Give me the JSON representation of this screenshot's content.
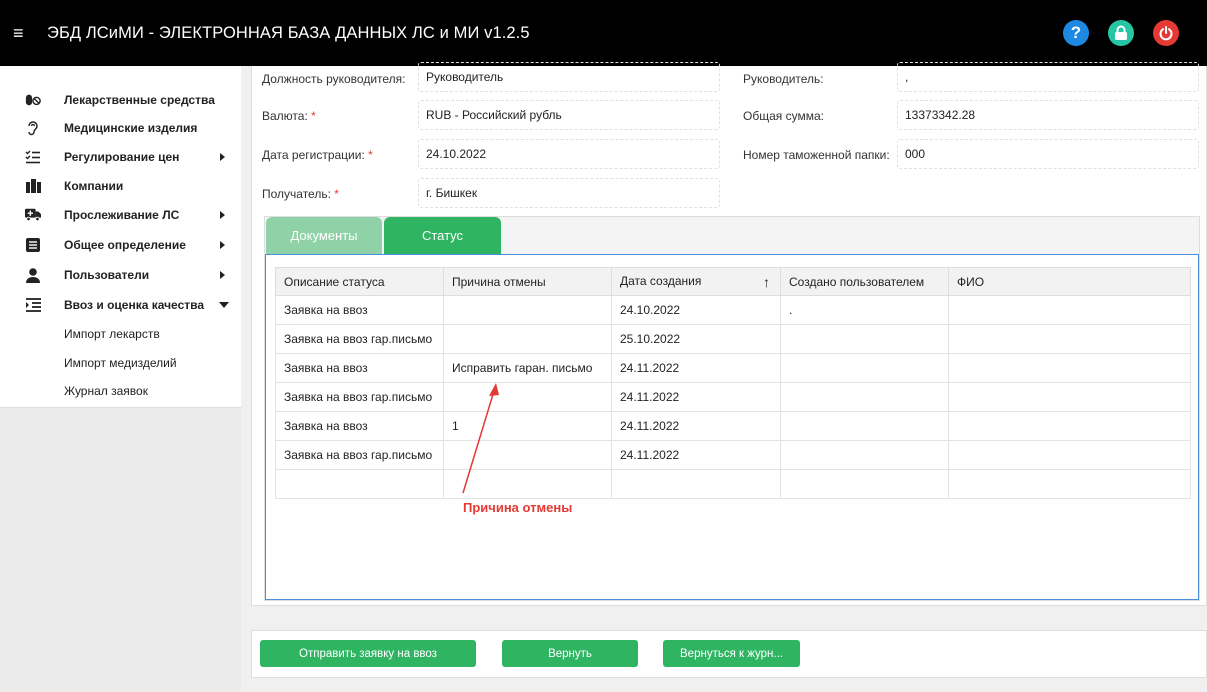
{
  "app": {
    "title": "ЭБД ЛСиМИ - ЭЛЕКТРОННАЯ БАЗА ДАННЫХ ЛС и МИ v1.2.5",
    "menu_glyph": "≡",
    "icons": [
      "help-icon",
      "lock-icon",
      "power-icon"
    ],
    "colors": {
      "accent_green": "#2fb562",
      "help_blue": "#1e88e5",
      "lock_teal": "#26c6a4",
      "power_red": "#e53935"
    }
  },
  "sidebar": {
    "items": [
      {
        "label": "Лекарственные средства",
        "icon": "pills-icon",
        "glyph": "💊"
      },
      {
        "label": "Медицинские изделия",
        "icon": "hearing-icon",
        "glyph": "👂"
      },
      {
        "label": "Регулирование цен",
        "icon": "list-check-icon",
        "glyph": "☰"
      },
      {
        "label": "Компании",
        "icon": "building-icon",
        "glyph": "▥"
      },
      {
        "label": "Прослеживание ЛС",
        "icon": "ambulance-icon",
        "glyph": "✚"
      },
      {
        "label": "Общее определение",
        "icon": "list-box-icon",
        "glyph": "▤"
      },
      {
        "label": "Пользователи",
        "icon": "user-icon",
        "glyph": "●"
      },
      {
        "label": "Ввоз и оценка качества",
        "icon": "indent-icon",
        "glyph": "☰"
      }
    ],
    "subitems": [
      "Импорт лекарств",
      "Импорт медизделий",
      "Журнал заявок"
    ]
  },
  "form": {
    "manager_position_label": "Должность руководителя:",
    "manager_position_value": "Руководитель",
    "manager_label": "Руководитель:",
    "manager_value": ",",
    "currency_label": "Валюта:",
    "currency_value": "RUB - Российский рубль",
    "total_label": "Общая сумма:",
    "total_value": "13373342.28",
    "reg_date_label": "Дата регистрации:",
    "reg_date_value": "24.10.2022",
    "customs_label": "Номер таможенной папки:",
    "customs_value": "000",
    "recipient_label": "Получатель:",
    "recipient_value": "г. Бишкек",
    "required_mark": "*"
  },
  "tabs": [
    {
      "label": "Документы",
      "active": false
    },
    {
      "label": "Статус",
      "active": true
    }
  ],
  "grid": {
    "columns": [
      "Описание статуса",
      "Причина отмены",
      "Дата создания",
      "Создано пользователем",
      "ФИО"
    ],
    "sort_glyph": "↑",
    "rows": [
      [
        "Заявка на ввоз",
        "",
        "24.10.2022",
        ".",
        ""
      ],
      [
        "Заявка на ввоз гар.письмо",
        "",
        "25.10.2022",
        "",
        ""
      ],
      [
        "Заявка на ввоз",
        "Исправить гаран. письмо",
        "24.11.2022",
        "",
        ""
      ],
      [
        "Заявка на ввоз гар.письмо",
        "",
        "24.11.2022",
        "",
        ""
      ],
      [
        "Заявка на ввоз",
        "1",
        "24.11.2022",
        "",
        ""
      ],
      [
        "Заявка на ввоз гар.письмо",
        "",
        "24.11.2022",
        "",
        ""
      ]
    ]
  },
  "annotation": {
    "text": "Причина отмены"
  },
  "buttons": {
    "send": "Отправить заявку на ввоз",
    "return": "Вернуть",
    "back_to_journal": "Вернуться к журн..."
  }
}
